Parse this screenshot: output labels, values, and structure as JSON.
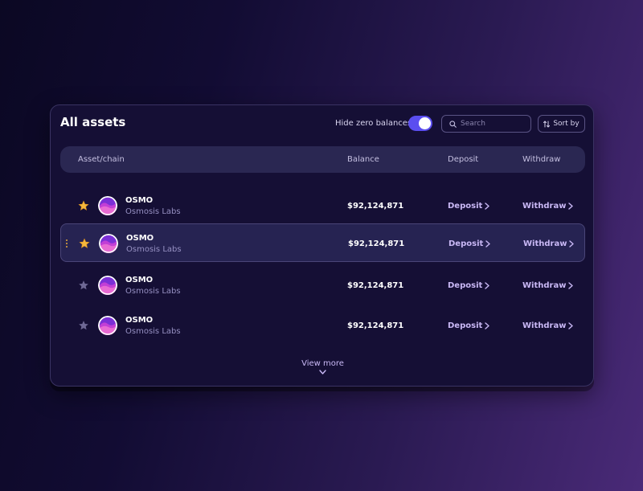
{
  "card": {
    "title": "All assets",
    "hide_zero_label": "Hide zero balances",
    "hide_zero_enabled": true,
    "search_placeholder": "Search",
    "sort_label": "Sort by"
  },
  "columns": {
    "asset": "Asset/chain",
    "balance": "Balance",
    "deposit": "Deposit",
    "withdraw": "Withdraw"
  },
  "rows": [
    {
      "name": "OSMO",
      "chain": "Osmosis Labs",
      "balance": "$92,124,871",
      "deposit": "Deposit",
      "withdraw": "Withdraw",
      "favorite": true
    },
    {
      "name": "OSMO",
      "chain": "Osmosis Labs",
      "balance": "$92,124,871",
      "deposit": "Deposit",
      "withdraw": "Withdraw",
      "favorite": true
    },
    {
      "name": "OSMO",
      "chain": "Osmosis Labs",
      "balance": "$92,124,871",
      "deposit": "Deposit",
      "withdraw": "Withdraw",
      "favorite": false
    },
    {
      "name": "OSMO",
      "chain": "Osmosis Labs",
      "balance": "$92,124,871",
      "deposit": "Deposit",
      "withdraw": "Withdraw",
      "favorite": false
    }
  ],
  "view_more": "View more",
  "colors": {
    "accent": "#5b4ef0",
    "link": "#c9b8f5",
    "star_active": "#f5b83d",
    "star_inactive": "#6e6894"
  }
}
